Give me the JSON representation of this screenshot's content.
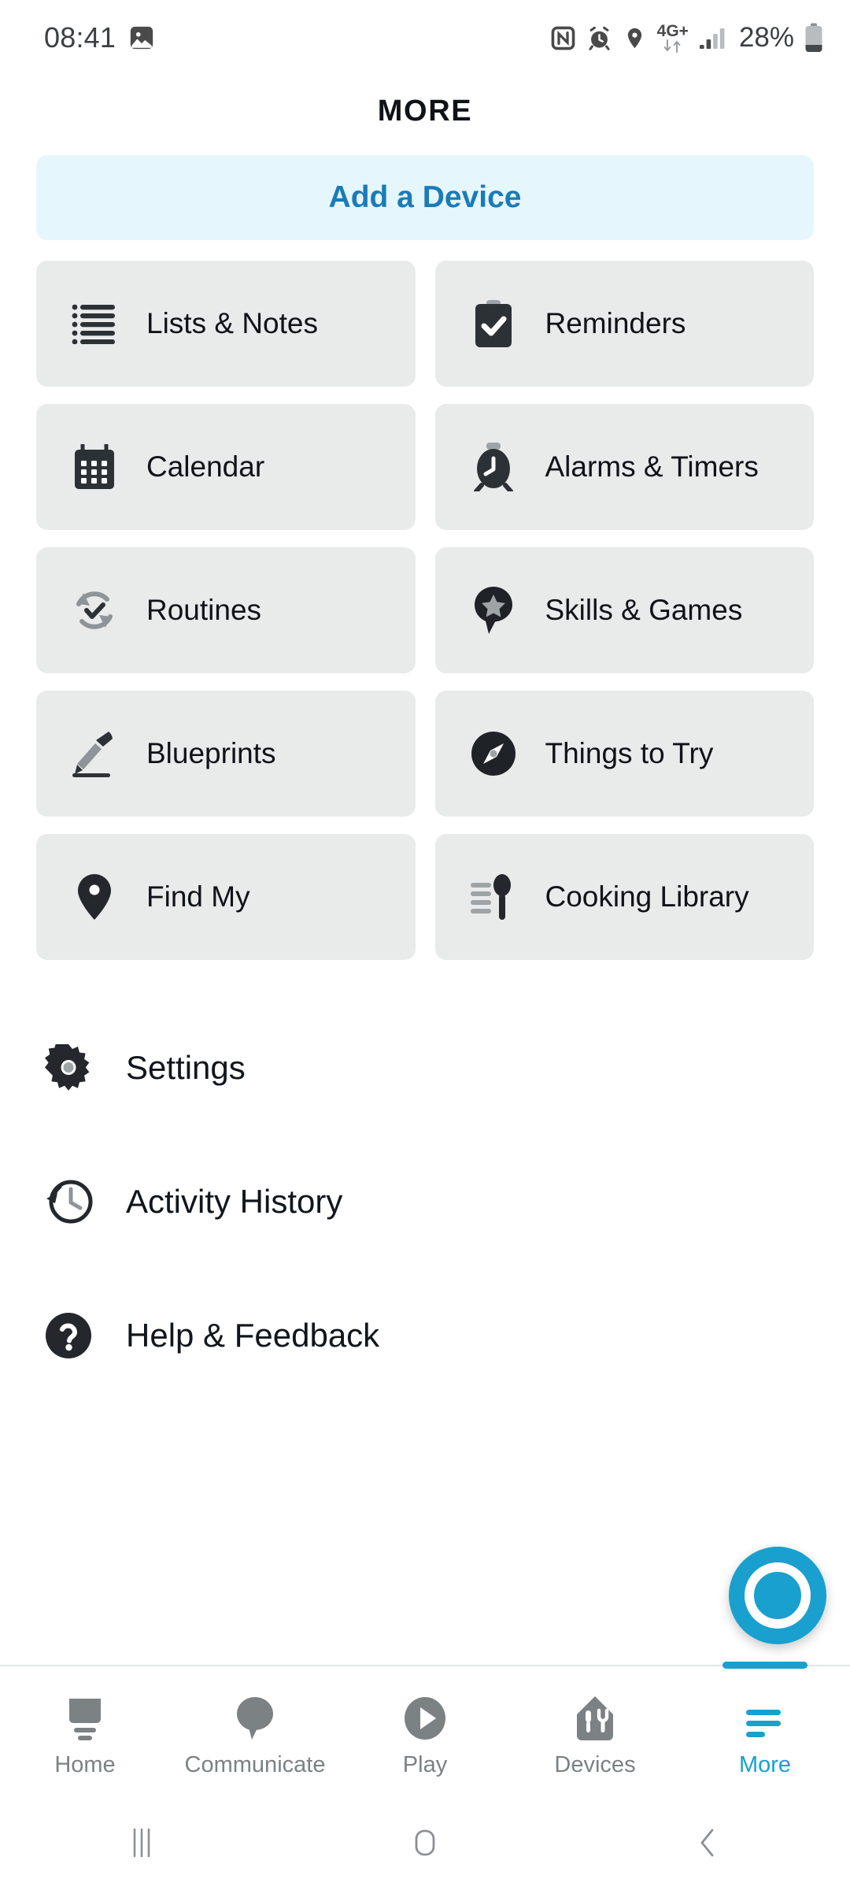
{
  "status_bar": {
    "time": "08:41",
    "battery_percent": "28%",
    "network_label": "4G+",
    "icons": [
      "photo-icon",
      "nfc-icon",
      "alarm-icon",
      "location-icon",
      "data-transfer-icon",
      "signal-icon",
      "battery-icon"
    ]
  },
  "header": {
    "title": "MORE"
  },
  "add_device": {
    "label": "Add a Device",
    "bg": "#e6f6fd",
    "text_color": "#1a7cb7"
  },
  "grid": {
    "tiles": [
      {
        "label": "Lists & Notes",
        "icon": "list-icon"
      },
      {
        "label": "Reminders",
        "icon": "clipboard-check-icon"
      },
      {
        "label": "Calendar",
        "icon": "calendar-icon"
      },
      {
        "label": "Alarms & Timers",
        "icon": "alarm-clock-icon"
      },
      {
        "label": "Routines",
        "icon": "refresh-check-icon"
      },
      {
        "label": "Skills & Games",
        "icon": "star-pin-icon"
      },
      {
        "label": "Blueprints",
        "icon": "pencil-icon"
      },
      {
        "label": "Things to Try",
        "icon": "compass-icon"
      },
      {
        "label": "Find My",
        "icon": "map-pin-icon"
      },
      {
        "label": "Cooking Library",
        "icon": "spoon-recipe-icon"
      }
    ],
    "tile_bg": "#e9eaea"
  },
  "menu": {
    "items": [
      {
        "label": "Settings",
        "icon": "gear-icon"
      },
      {
        "label": "Activity History",
        "icon": "history-clock-icon"
      },
      {
        "label": "Help & Feedback",
        "icon": "question-circle-icon"
      }
    ]
  },
  "fab": {
    "icon": "alexa-icon",
    "color": "#19a0cf"
  },
  "bottom_nav": {
    "active_color": "#18a0d0",
    "inactive_color": "#7c8183",
    "items": [
      {
        "label": "Home",
        "icon": "home-icon",
        "active": false
      },
      {
        "label": "Communicate",
        "icon": "chat-bubble-icon",
        "active": false
      },
      {
        "label": "Play",
        "icon": "play-circle-icon",
        "active": false
      },
      {
        "label": "Devices",
        "icon": "devices-icon",
        "active": false
      },
      {
        "label": "More",
        "icon": "hamburger-icon",
        "active": true
      }
    ]
  },
  "android_nav": {
    "buttons": [
      {
        "name": "recents-icon"
      },
      {
        "name": "home-square-icon"
      },
      {
        "name": "back-chevron-icon"
      }
    ]
  }
}
